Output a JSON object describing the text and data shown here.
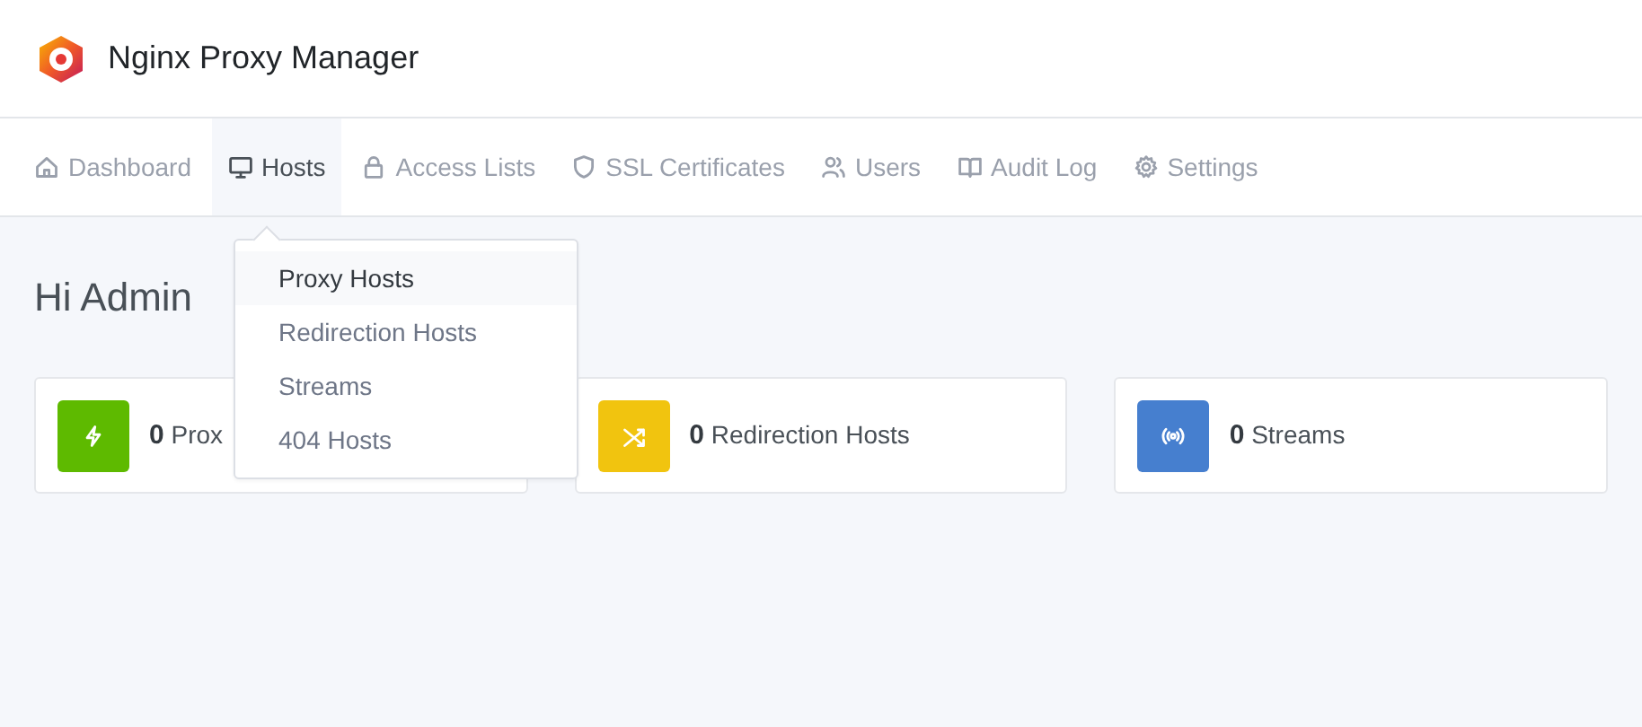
{
  "app": {
    "title": "Nginx Proxy Manager"
  },
  "nav": [
    {
      "label": "Dashboard",
      "selected": false
    },
    {
      "label": "Hosts",
      "selected": true,
      "menu": [
        {
          "label": "Proxy Hosts",
          "selected": true
        },
        {
          "label": "Redirection Hosts",
          "selected": false
        },
        {
          "label": "Streams",
          "selected": false
        },
        {
          "label": "404 Hosts",
          "selected": false
        }
      ]
    },
    {
      "label": "Access Lists",
      "selected": false
    },
    {
      "label": "SSL Certificates",
      "selected": false
    },
    {
      "label": "Users",
      "selected": false
    },
    {
      "label": "Audit Log",
      "selected": false
    },
    {
      "label": "Settings",
      "selected": false
    }
  ],
  "greeting": "Hi Admin",
  "cards": [
    {
      "count": "0",
      "label": "Prox",
      "color": "#5eba00"
    },
    {
      "count": "0",
      "label": "Redirection Hosts",
      "color": "#f1c40f"
    },
    {
      "count": "0",
      "label": "Streams",
      "color": "#467fcf"
    }
  ]
}
